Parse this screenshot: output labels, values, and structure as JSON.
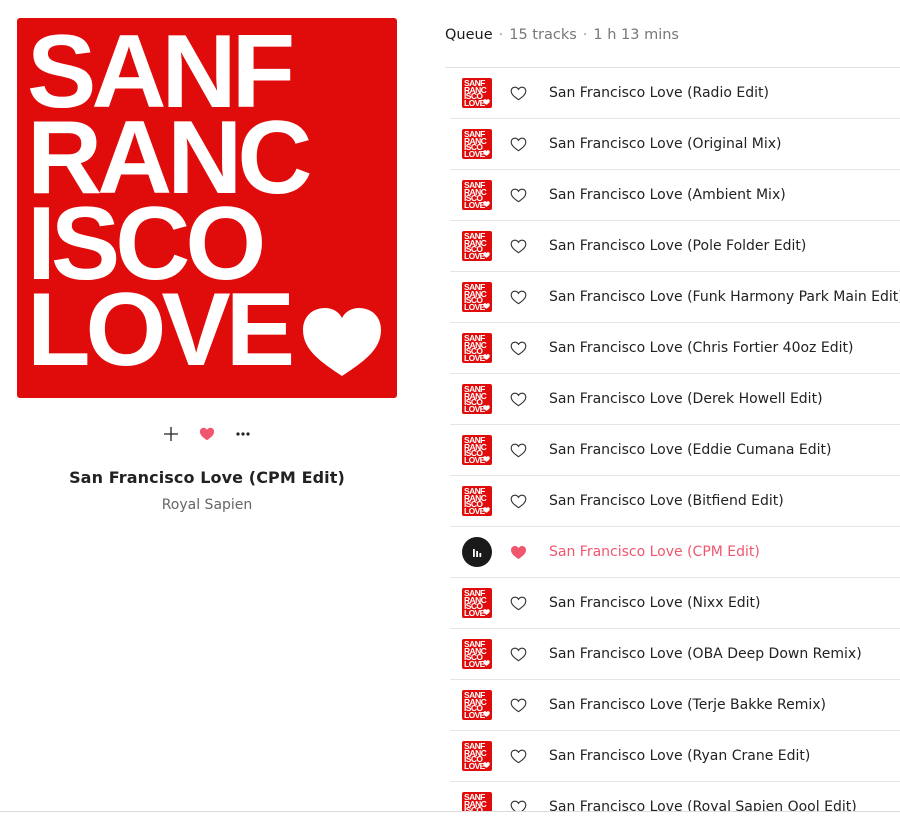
{
  "album_cover": {
    "lines": [
      "SANF",
      "RANC",
      "ISCO",
      "LOVE"
    ],
    "color": "#e00b0b"
  },
  "actions": {
    "add_icon": "plus-icon",
    "like_icon": "heart-filled-icon",
    "more_icon": "ellipsis-icon"
  },
  "now_playing": {
    "title": "San Francisco Love (CPM Edit)",
    "artist": "Royal Sapien",
    "liked": true
  },
  "queue": {
    "label": "Queue",
    "track_count": "15 tracks",
    "duration": "1 h 13 mins",
    "tracks": [
      {
        "title": "San Francisco Love (Radio Edit)",
        "liked": false,
        "playing": false
      },
      {
        "title": "San Francisco Love (Original Mix)",
        "liked": false,
        "playing": false
      },
      {
        "title": "San Francisco Love (Ambient Mix)",
        "liked": false,
        "playing": false
      },
      {
        "title": "San Francisco Love (Pole Folder Edit)",
        "liked": false,
        "playing": false
      },
      {
        "title": "San Francisco Love (Funk Harmony Park Main Edit)",
        "liked": false,
        "playing": false
      },
      {
        "title": "San Francisco Love (Chris Fortier 40oz Edit)",
        "liked": false,
        "playing": false
      },
      {
        "title": "San Francisco Love (Derek Howell Edit)",
        "liked": false,
        "playing": false
      },
      {
        "title": "San Francisco Love (Eddie Cumana Edit)",
        "liked": false,
        "playing": false
      },
      {
        "title": "San Francisco Love (Bitfiend Edit)",
        "liked": false,
        "playing": false
      },
      {
        "title": "San Francisco Love (CPM Edit)",
        "liked": true,
        "playing": true
      },
      {
        "title": "San Francisco Love (Nixx Edit)",
        "liked": false,
        "playing": false
      },
      {
        "title": "San Francisco Love (OBA Deep Down Remix)",
        "liked": false,
        "playing": false
      },
      {
        "title": "San Francisco Love (Terje Bakke Remix)",
        "liked": false,
        "playing": false
      },
      {
        "title": "San Francisco Love (Ryan Crane Edit)",
        "liked": false,
        "playing": false
      },
      {
        "title": "San Francisco Love (Royal Sapien Oool Edit)",
        "liked": false,
        "playing": false
      }
    ]
  },
  "colors": {
    "accent_pink": "#f0566e",
    "cover_red": "#e00b0b",
    "text": "#1a1a1a"
  }
}
